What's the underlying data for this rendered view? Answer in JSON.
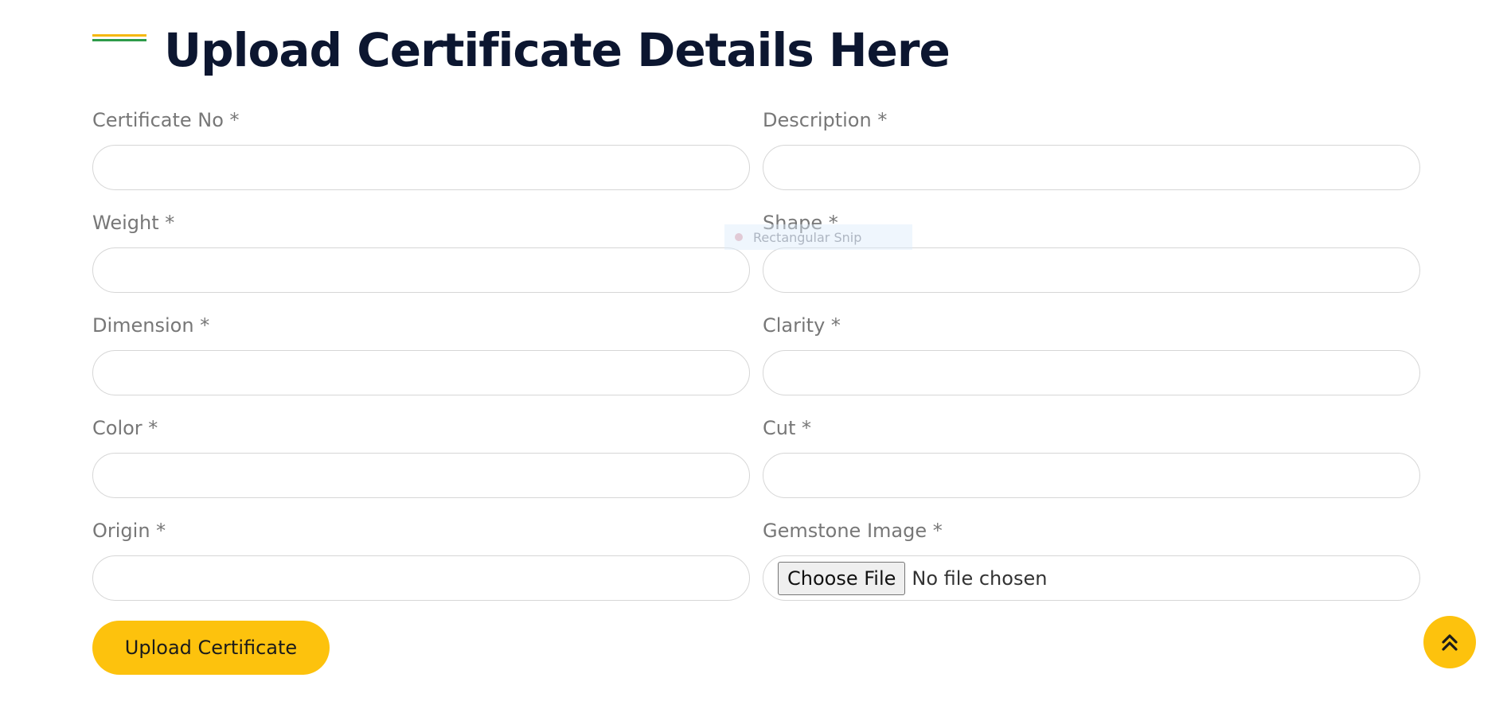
{
  "heading": {
    "title": "Upload Certificate Details Here"
  },
  "form": {
    "fields": [
      {
        "label": "Certificate No *",
        "value": ""
      },
      {
        "label": "Description *",
        "value": ""
      },
      {
        "label": "Weight *",
        "value": ""
      },
      {
        "label": "Shape *",
        "value": ""
      },
      {
        "label": "Dimension *",
        "value": ""
      },
      {
        "label": "Clarity *",
        "value": ""
      },
      {
        "label": "Color *",
        "value": ""
      },
      {
        "label": "Cut *",
        "value": ""
      },
      {
        "label": "Origin *",
        "value": ""
      }
    ],
    "image": {
      "label": "Gemstone Image *",
      "button": "Choose File",
      "status": "No file chosen"
    },
    "submit_label": "Upload Certificate"
  },
  "overlay": {
    "snip_text": "Rectangular Snip"
  },
  "icons": {
    "scroll_top": "double-chevron-up-icon"
  },
  "colors": {
    "accent_yellow": "#fdc20d",
    "accent_green": "#2e9b4a",
    "title": "#0c1630",
    "label": "#777777"
  }
}
